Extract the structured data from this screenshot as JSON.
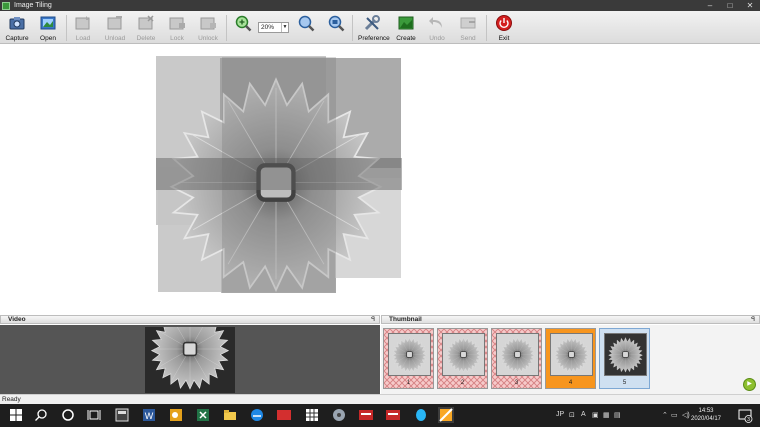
{
  "window": {
    "title": "Image Tiling",
    "min": "–",
    "max": "□",
    "close": "✕"
  },
  "toolbar": {
    "capture": "Capture",
    "open": "Open",
    "load": "Load",
    "unload": "Unload",
    "delete": "Delete",
    "lock": "Lock",
    "unlock": "Unlock",
    "zoom_value": "20%",
    "preference": "Preference",
    "create": "Create",
    "undo": "Undo",
    "send": "Send",
    "exit": "Exit"
  },
  "video_panel": {
    "title": "Video",
    "pin": "ꟼ"
  },
  "thumbnail_panel": {
    "title": "Thumbnail",
    "pin": "ꟼ",
    "thumbs": [
      {
        "number": "1",
        "state": "pink"
      },
      {
        "number": "2",
        "state": "pink"
      },
      {
        "number": "3",
        "state": "pink"
      },
      {
        "number": "4",
        "state": "orange"
      },
      {
        "number": "5",
        "state": "selected"
      }
    ]
  },
  "status": {
    "text": "Ready"
  },
  "taskbar": {
    "ime": "JP",
    "font_indicator": "A",
    "time": "14:53",
    "date": "2020/04/17",
    "notifications": "3"
  },
  "colors": {
    "accent_orange": "#f7951e",
    "selected_blue": "#cfe0f1",
    "ribbon": "#e8e8e8"
  }
}
